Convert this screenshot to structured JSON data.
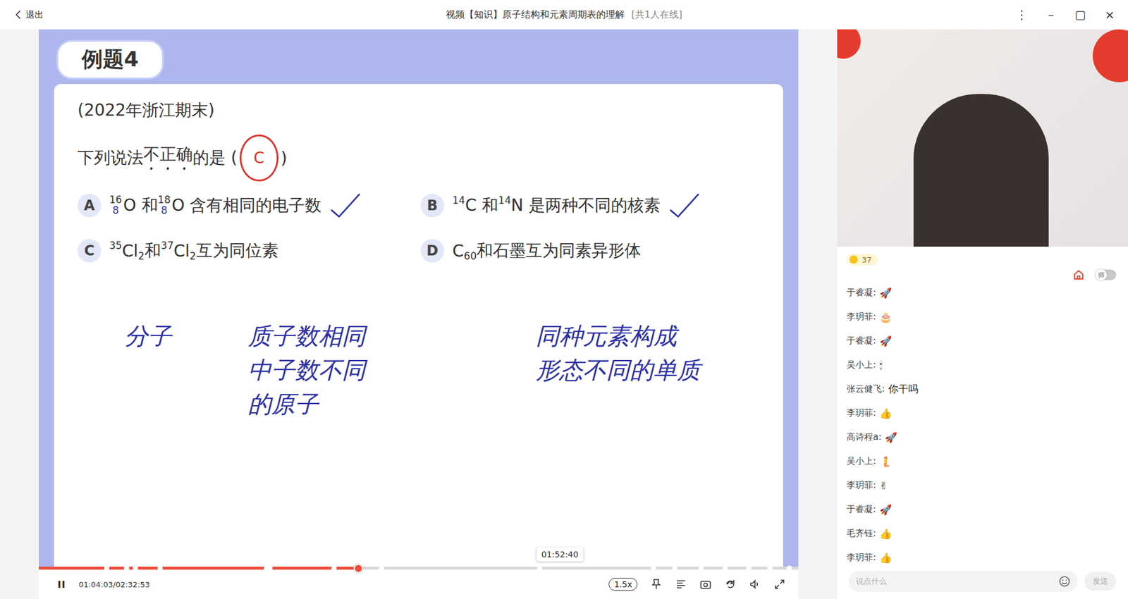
{
  "window": {
    "back": "退出",
    "title": "视频【知识】原子结构和元素周期表的理解",
    "online": "[共1人在线]",
    "controls": [
      "⋮",
      "–",
      "▢",
      "×"
    ]
  },
  "slide": {
    "badge": "例题4",
    "source": "(2022年浙江期末)",
    "question": [
      {
        "text": "下列说法",
        "emphasis": false
      },
      {
        "text": "不正确",
        "emphasis": true
      },
      {
        "text": "的是 (",
        "emphasis": false
      }
    ],
    "answer": "C",
    "question_end": ")",
    "options": [
      {
        "letter": "A",
        "checked": true,
        "segments": [
          {
            "kind": "iso",
            "mass": "16",
            "z": "8"
          },
          {
            "kind": "text",
            "t": "O 和 "
          },
          {
            "kind": "iso",
            "mass": "18",
            "z": "8"
          },
          {
            "kind": "text",
            "t": "O 含有相同的电子数"
          }
        ]
      },
      {
        "letter": "B",
        "checked": true,
        "segments": [
          {
            "kind": "sup",
            "t": "14"
          },
          {
            "kind": "text",
            "t": "C 和 "
          },
          {
            "kind": "sup",
            "t": "14"
          },
          {
            "kind": "text",
            "t": "N 是两种不同的核素"
          }
        ]
      },
      {
        "letter": "C",
        "checked": false,
        "segments": [
          {
            "kind": "sup",
            "t": "35"
          },
          {
            "kind": "text",
            "t": "Cl"
          },
          {
            "kind": "sub",
            "t": "2"
          },
          {
            "kind": "text",
            "t": " 和 "
          },
          {
            "kind": "sup",
            "t": "37"
          },
          {
            "kind": "text",
            "t": "Cl"
          },
          {
            "kind": "sub",
            "t": "2"
          },
          {
            "kind": "text",
            "t": " 互为同位素"
          }
        ]
      },
      {
        "letter": "D",
        "checked": false,
        "segments": [
          {
            "kind": "text",
            "t": "C"
          },
          {
            "kind": "sub",
            "t": "60"
          },
          {
            "kind": "text",
            "t": " 和石墨互为同素异形体"
          }
        ]
      }
    ],
    "notes": [
      [
        "分子"
      ],
      [
        "质子数相同",
        "中子数不同",
        "的原子"
      ],
      [
        "同种元素构成",
        "形态不同的单质"
      ]
    ]
  },
  "player": {
    "playing": true,
    "time": "01:04:03/02:32:53",
    "level": 0.419,
    "hover_time": "01:52:40",
    "hover_level": 0.686,
    "speed": "1.5x",
    "pause_glyph": "II",
    "markers": [
      0.089,
      0.115,
      0.127,
      0.159,
      0.299,
      0.304,
      0.388,
      0.451,
      0.659,
      0.809,
      0.837,
      0.872,
      0.903,
      0.934,
      0.962,
      0.988
    ]
  },
  "sidebar": {
    "coins": "37",
    "teacher_toggle": {
      "label": "师",
      "on": false
    },
    "chat": [
      {
        "name": "于睿凝:",
        "msg": "🚀"
      },
      {
        "name": "李玥菲:",
        "msg": "🎂"
      },
      {
        "name": "于睿凝:",
        "msg": "🚀"
      },
      {
        "name": "吴小上:",
        "msg": "🕯"
      },
      {
        "name": "张云健飞:",
        "msg": "你干吗"
      },
      {
        "name": "李玥菲:",
        "msg": "👍"
      },
      {
        "name": "高诗程a:",
        "msg": "🚀"
      },
      {
        "name": "吴小上:",
        "msg": "🧜"
      },
      {
        "name": "李玥菲:",
        "msg": "✌"
      },
      {
        "name": "于睿凝:",
        "msg": "🚀"
      },
      {
        "name": "毛齐钰:",
        "msg": "👍"
      },
      {
        "name": "李玥菲:",
        "msg": "👍"
      }
    ],
    "input": {
      "placeholder": "说点什么",
      "send": "发送",
      "send_disabled": true
    }
  }
}
